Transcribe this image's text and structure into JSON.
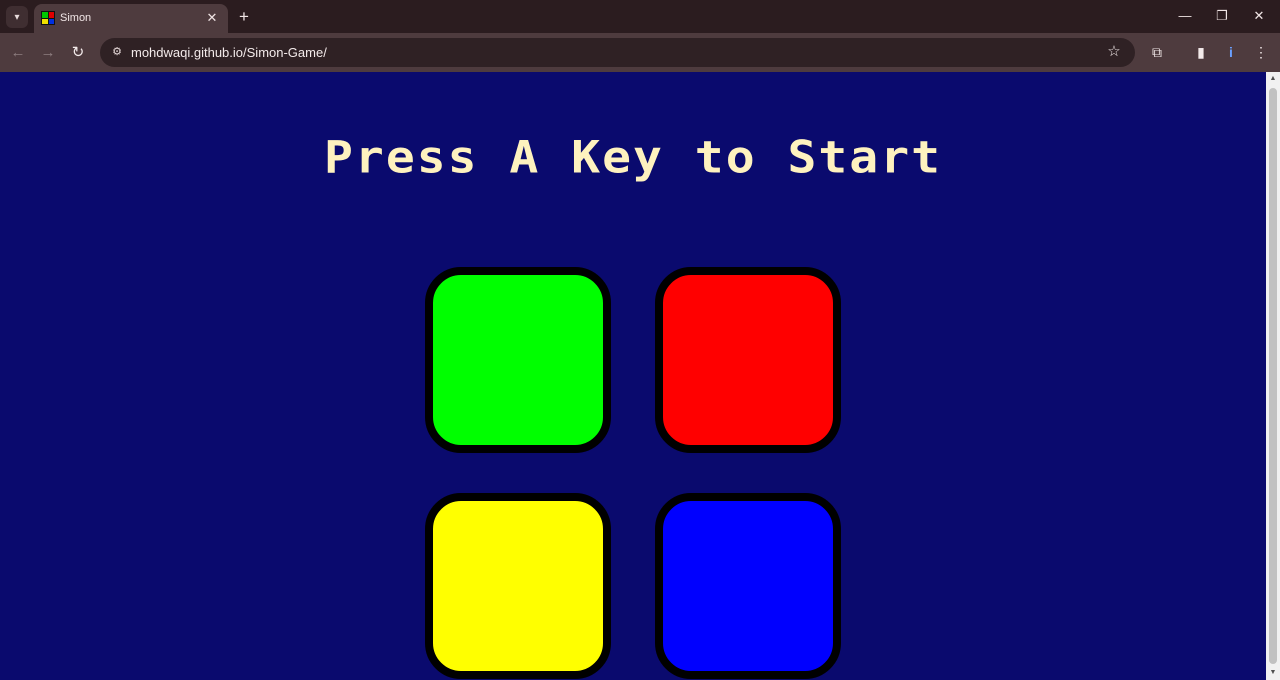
{
  "browser": {
    "tab": {
      "title": "Simon",
      "close_glyph": "✕"
    },
    "new_tab_glyph": "+",
    "window": {
      "minimize_glyph": "—",
      "restore_glyph": "❐",
      "close_glyph": "✕"
    },
    "toolbar": {
      "back_glyph": "←",
      "forward_glyph": "→",
      "reload_glyph": "↻",
      "url": "mohdwaqi.github.io/Simon-Game/",
      "bookmark_glyph": "☆",
      "extensions_glyph": "⧉",
      "sidepanel_glyph": "▮",
      "profile_glyph": "i",
      "menu_glyph": "⋮"
    }
  },
  "page": {
    "title": "Press A Key to Start",
    "buttons": [
      {
        "id": "green",
        "color": "#00FF00"
      },
      {
        "id": "red",
        "color": "#FF0000"
      },
      {
        "id": "yellow",
        "color": "#FFFF00"
      },
      {
        "id": "blue",
        "color": "#0000FF"
      }
    ],
    "background_color": "#0A0A6E",
    "title_color": "#FEF2BF"
  }
}
